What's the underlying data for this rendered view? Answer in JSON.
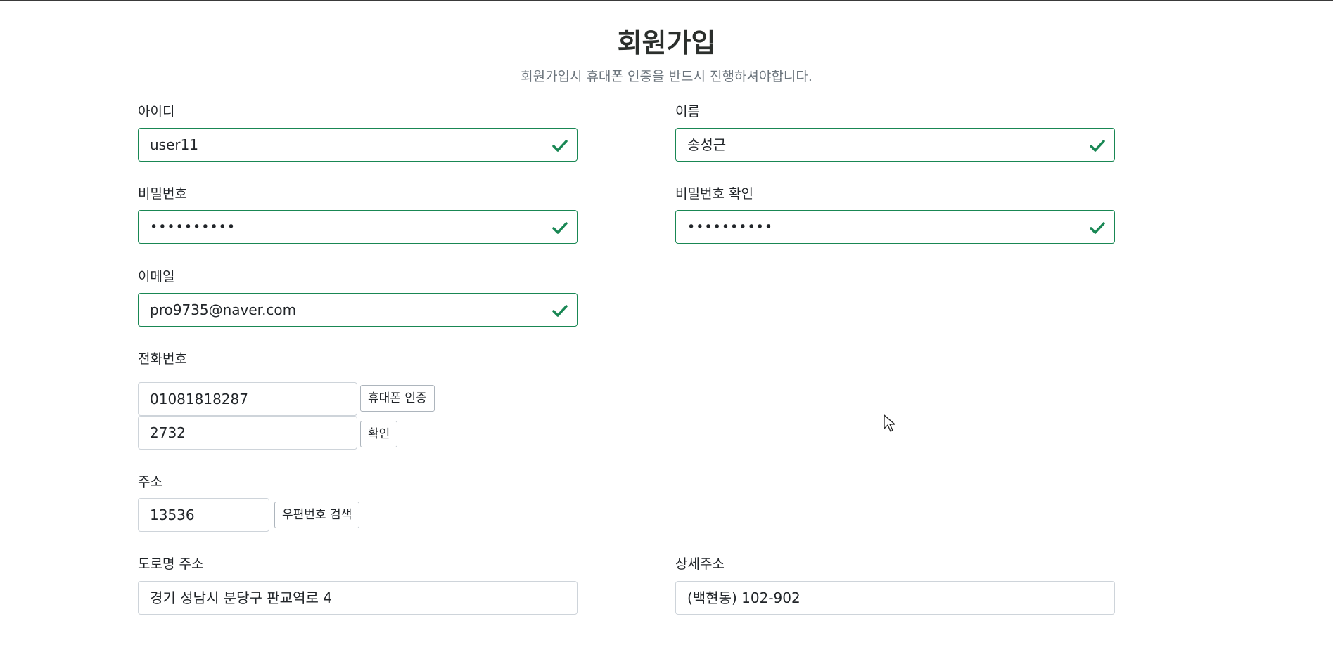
{
  "page": {
    "title": "회원가입",
    "subtitle": "회원가입시 휴대폰 인증을 반드시 진행하셔야합니다."
  },
  "form": {
    "username": {
      "label": "아이디",
      "value": "user11",
      "valid": true
    },
    "name": {
      "label": "이름",
      "value": "송성근",
      "valid": true
    },
    "password": {
      "label": "비밀번호",
      "value": "••••••••••",
      "valid": true
    },
    "password_confirm": {
      "label": "비밀번호 확인",
      "value": "••••••••••",
      "valid": true
    },
    "email": {
      "label": "이메일",
      "value": "pro9735@naver.com",
      "valid": true
    },
    "phone": {
      "label": "전화번호",
      "value": "01081818287",
      "verify_button": "휴대폰 인증",
      "code_value": "2732",
      "confirm_button": "확인"
    },
    "address": {
      "label": "주소",
      "zipcode": "13536",
      "search_button": "우편번호 검색"
    },
    "road_address": {
      "label": "도로명 주소",
      "value": "경기 성남시 분당구 판교역로 4"
    },
    "detail_address": {
      "label": "상세주소",
      "value": "(백현동) 102-902"
    }
  },
  "colors": {
    "valid": "#198754",
    "border": "#ced4da",
    "heading": "#2b2f2c",
    "muted": "#6c757d"
  },
  "icons": {
    "valid_check": "check-icon",
    "cursor": "mouse-pointer-icon"
  }
}
